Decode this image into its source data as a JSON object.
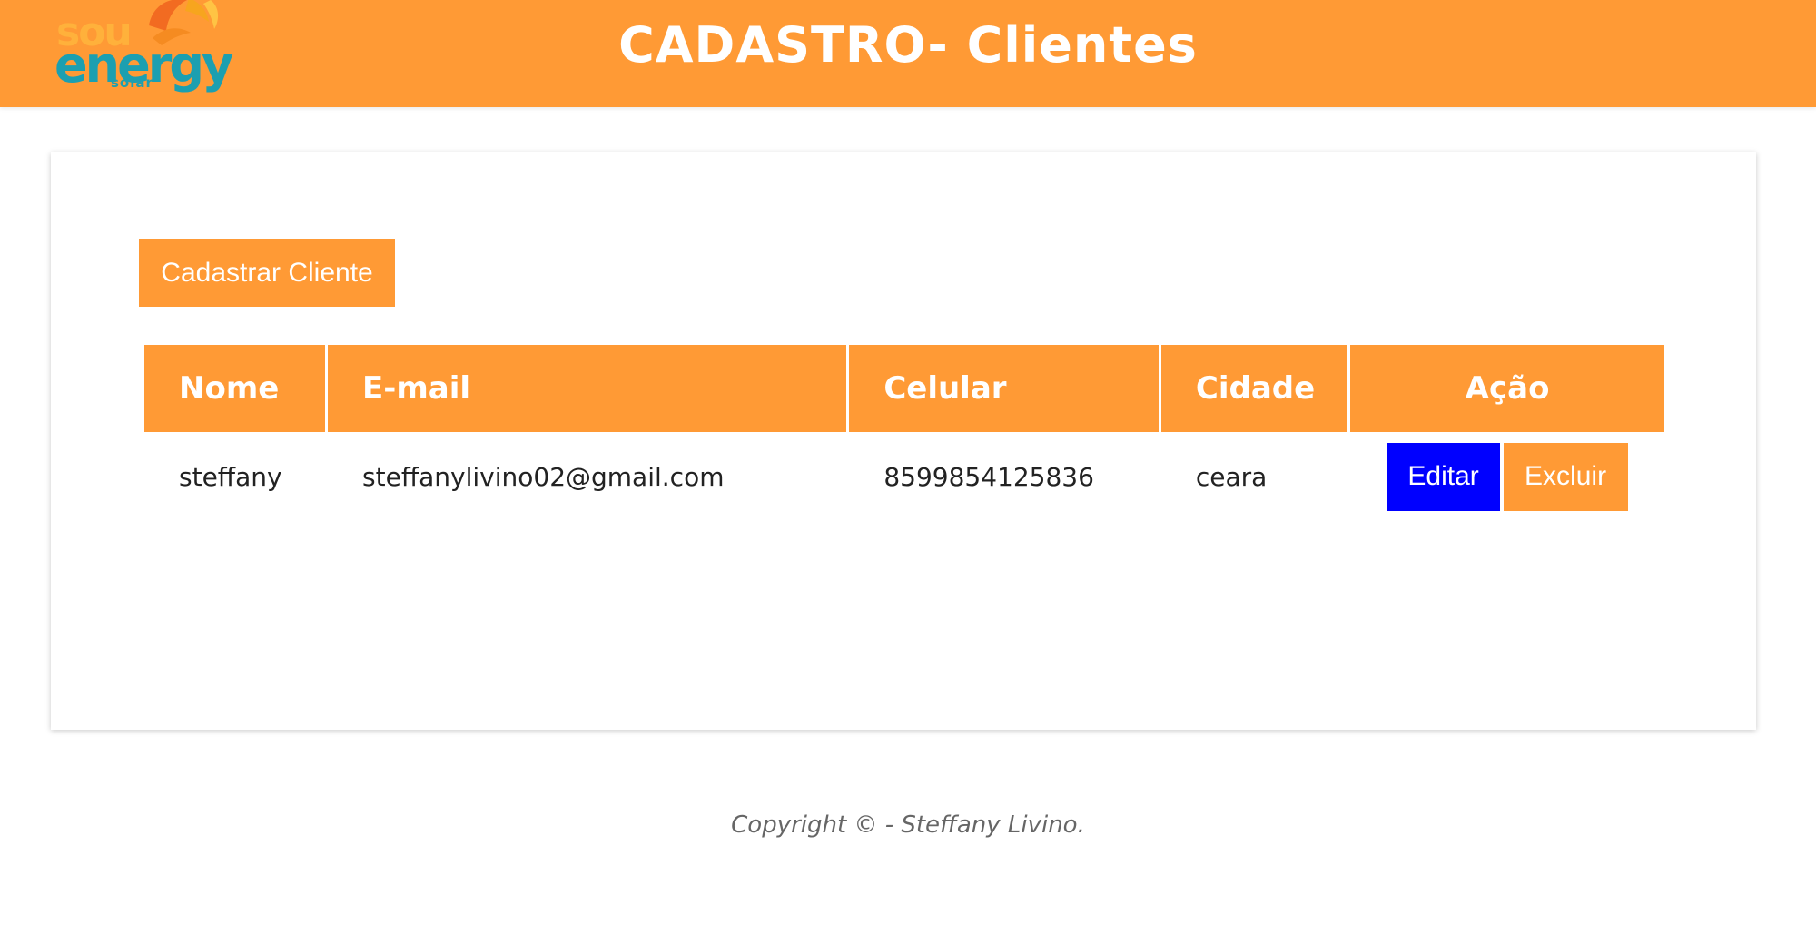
{
  "brand": {
    "logo_top": "sou",
    "logo_main": "energy",
    "logo_sub": "solar",
    "primary_color": "#FF9A35",
    "logo_teal": "#1C9FB0",
    "edit_button_color": "#0000FF"
  },
  "header": {
    "title": "CADASTRO- Clientes"
  },
  "actions": {
    "register_label": "Cadastrar Cliente"
  },
  "table": {
    "headers": {
      "nome": "Nome",
      "email": "E-mail",
      "celular": "Celular",
      "cidade": "Cidade",
      "acao": "Ação"
    },
    "rows": [
      {
        "nome": "steffany",
        "email": "steffanylivino02@gmail.com",
        "celular": "8599854125836",
        "cidade": "ceara",
        "edit_label": "Editar",
        "delete_label": "Excluir"
      }
    ]
  },
  "footer": {
    "copyright": "Copyright © - Steffany Livino."
  }
}
